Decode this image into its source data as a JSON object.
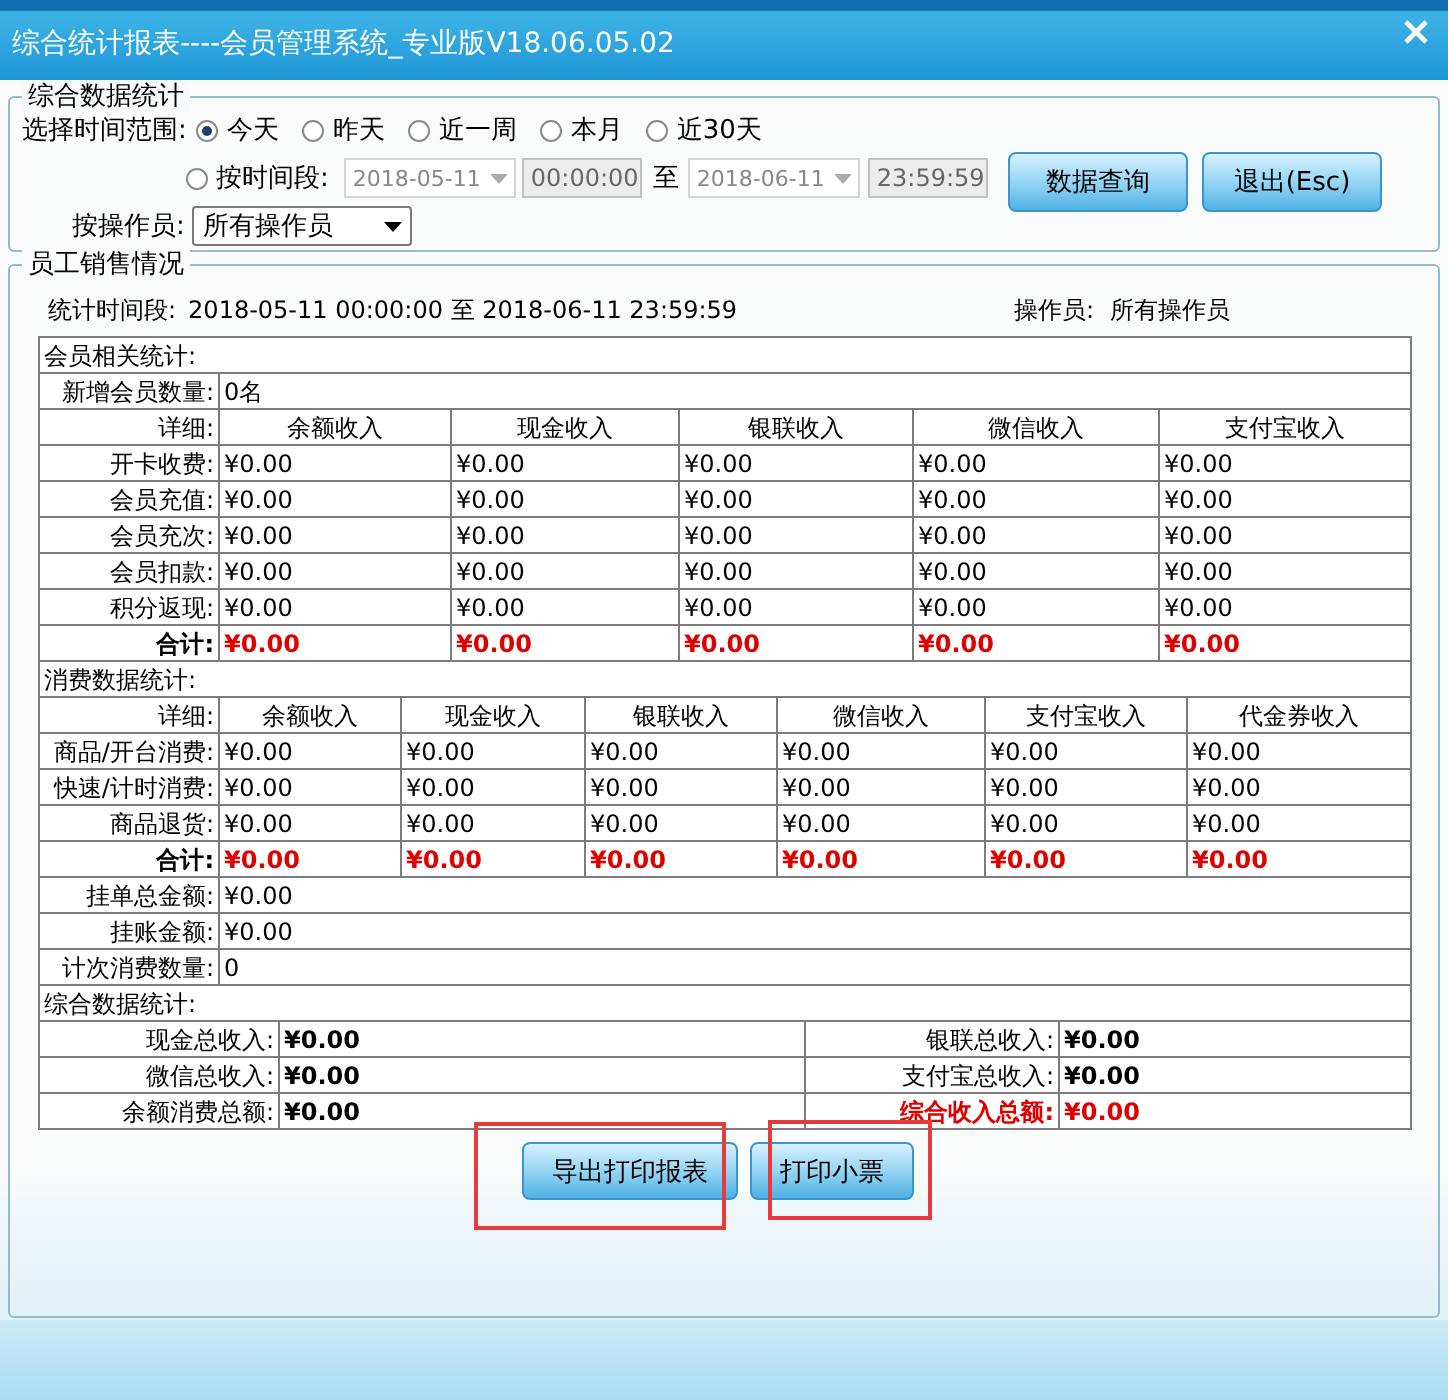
{
  "window": {
    "title": "综合统计报表----会员管理系统_专业版V18.06.05.02"
  },
  "filter": {
    "legend": "综合数据统计",
    "range_label": "选择时间范围:",
    "ranges": [
      {
        "label": "今天",
        "selected": true
      },
      {
        "label": "昨天",
        "selected": false
      },
      {
        "label": "近一周",
        "selected": false
      },
      {
        "label": "本月",
        "selected": false
      },
      {
        "label": "近30天",
        "selected": false
      }
    ],
    "custom": {
      "label": "按时间段:",
      "selected": false,
      "disabled": true,
      "start_date": "2018-05-11",
      "start_time": "00:00:00",
      "to": "至",
      "end_date": "2018-06-11",
      "end_time": "23:59:59"
    },
    "operator_label": "按操作员:",
    "operator": "所有操作员",
    "buttons": [
      "数据查询",
      "退出(Esc)"
    ]
  },
  "report": {
    "legend": "员工销售情况",
    "period_label": "统计时间段:",
    "period": "2018-05-11 00:00:00 至 2018-06-11 23:59:59",
    "operator_label": "操作员:",
    "operator": "所有操作员",
    "member": {
      "title": "会员相关统计:",
      "new_label": "新增会员数量:",
      "new_value": "0名",
      "detail_label": "详细:",
      "columns": [
        "余额收入",
        "现金收入",
        "银联收入",
        "微信收入",
        "支付宝收入"
      ],
      "rows": [
        {
          "label": "开卡收费:",
          "values": [
            "¥0.00",
            "¥0.00",
            "¥0.00",
            "¥0.00",
            "¥0.00"
          ]
        },
        {
          "label": "会员充值:",
          "values": [
            "¥0.00",
            "¥0.00",
            "¥0.00",
            "¥0.00",
            "¥0.00"
          ]
        },
        {
          "label": "会员充次:",
          "values": [
            "¥0.00",
            "¥0.00",
            "¥0.00",
            "¥0.00",
            "¥0.00"
          ]
        },
        {
          "label": "会员扣款:",
          "values": [
            "¥0.00",
            "¥0.00",
            "¥0.00",
            "¥0.00",
            "¥0.00"
          ]
        },
        {
          "label": "积分返现:",
          "values": [
            "¥0.00",
            "¥0.00",
            "¥0.00",
            "¥0.00",
            "¥0.00"
          ]
        }
      ],
      "total": {
        "label": "合计:",
        "values": [
          "¥0.00",
          "¥0.00",
          "¥0.00",
          "¥0.00",
          "¥0.00"
        ]
      }
    },
    "consumption": {
      "title": "消费数据统计:",
      "detail_label": "详细:",
      "columns": [
        "余额收入",
        "现金收入",
        "银联收入",
        "微信收入",
        "支付宝收入",
        "代金券收入"
      ],
      "rows": [
        {
          "label": "商品/开台消费:",
          "values": [
            "¥0.00",
            "¥0.00",
            "¥0.00",
            "¥0.00",
            "¥0.00",
            "¥0.00"
          ]
        },
        {
          "label": "快速/计时消费:",
          "values": [
            "¥0.00",
            "¥0.00",
            "¥0.00",
            "¥0.00",
            "¥0.00",
            "¥0.00"
          ]
        },
        {
          "label": "商品退货:",
          "values": [
            "¥0.00",
            "¥0.00",
            "¥0.00",
            "¥0.00",
            "¥0.00",
            "¥0.00"
          ]
        }
      ],
      "total": {
        "label": "合计:",
        "values": [
          "¥0.00",
          "¥0.00",
          "¥0.00",
          "¥0.00",
          "¥0.00",
          "¥0.00"
        ]
      },
      "extra_rows": [
        {
          "label": "挂单总金额:",
          "value": "¥0.00"
        },
        {
          "label": "挂账金额:",
          "value": "¥0.00"
        },
        {
          "label": "计次消费数量:",
          "value": "0"
        }
      ]
    },
    "summary": {
      "title": "综合数据统计:",
      "items": [
        {
          "label": "现金总收入:",
          "value": "¥0.00",
          "emphasis": false
        },
        {
          "label": "银联总收入:",
          "value": "¥0.00",
          "emphasis": false
        },
        {
          "label": "微信总收入:",
          "value": "¥0.00",
          "emphasis": false
        },
        {
          "label": "支付宝总收入:",
          "value": "¥0.00",
          "emphasis": false
        },
        {
          "label": "余额消费总额:",
          "value": "¥0.00",
          "emphasis": false
        },
        {
          "label": "综合收入总额:",
          "value": "¥0.00",
          "emphasis": true
        }
      ]
    },
    "buttons": [
      {
        "label": "导出打印报表",
        "highlighted": true
      },
      {
        "label": "打印小票",
        "highlighted": true
      }
    ]
  }
}
